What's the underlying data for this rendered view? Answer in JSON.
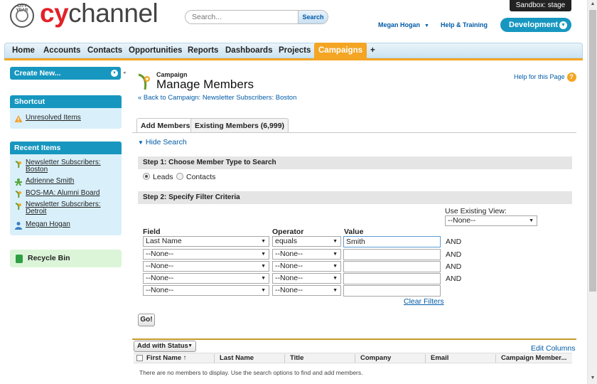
{
  "header": {
    "logo_brand": "cychannel",
    "logo_seal_text": "CITY YEAR",
    "search_placeholder": "Search...",
    "search_button": "Search",
    "user_name": "Megan Hogan",
    "help_link": "Help & Training",
    "app_menu": "Development",
    "sandbox_badge": "Sandbox:  stage"
  },
  "tabs": [
    {
      "label": "Home",
      "active": false
    },
    {
      "label": "Accounts",
      "active": false
    },
    {
      "label": "Contacts",
      "active": false
    },
    {
      "label": "Opportunities",
      "active": false
    },
    {
      "label": "Reports",
      "active": false
    },
    {
      "label": "Dashboards",
      "active": false
    },
    {
      "label": "Projects",
      "active": false
    },
    {
      "label": "Campaigns",
      "active": true
    },
    {
      "label": "+",
      "active": false
    }
  ],
  "sidebar": {
    "create_new": "Create New...",
    "shortcut_title": "Shortcut",
    "shortcut_items": [
      {
        "label": "Unresolved Items",
        "icon": "warning-icon"
      }
    ],
    "recent_title": "Recent Items",
    "recent_items": [
      {
        "label": "Newsletter Subscribers: Boston",
        "icon": "campaign-icon"
      },
      {
        "label": "Adrienne Smith",
        "icon": "lead-icon"
      },
      {
        "label": "BOS-MA: Alumni Board",
        "icon": "campaign-icon"
      },
      {
        "label": "Newsletter Subscribers: Detroit",
        "icon": "campaign-icon"
      },
      {
        "label": "Megan Hogan",
        "icon": "user-icon"
      }
    ],
    "recycle_bin": "Recycle Bin"
  },
  "page": {
    "type_label": "Campaign",
    "title": "Manage Members",
    "back_link": "« Back to Campaign: Newsletter Subscribers: Boston",
    "help_link": "Help for this Page",
    "subtabs": [
      {
        "label": "Add Members",
        "active": true
      },
      {
        "label": "Existing Members (6,999)",
        "active": false
      }
    ],
    "hide_search": "Hide Search",
    "step1_title": "Step 1: Choose Member Type to Search",
    "member_types": [
      {
        "label": "Leads",
        "selected": true
      },
      {
        "label": "Contacts",
        "selected": false
      }
    ],
    "step2_title": "Step 2: Specify Filter Criteria",
    "existing_view_label": "Use Existing View:",
    "existing_view_value": "--None--",
    "filter_headers": {
      "field": "Field",
      "operator": "Operator",
      "value": "Value"
    },
    "filters": [
      {
        "field": "Last Name",
        "operator": "equals",
        "value": "Smith",
        "conjunction": "AND"
      },
      {
        "field": "--None--",
        "operator": "--None--",
        "value": "",
        "conjunction": "AND"
      },
      {
        "field": "--None--",
        "operator": "--None--",
        "value": "",
        "conjunction": "AND"
      },
      {
        "field": "--None--",
        "operator": "--None--",
        "value": "",
        "conjunction": "AND"
      },
      {
        "field": "--None--",
        "operator": "--None--",
        "value": "",
        "conjunction": ""
      }
    ],
    "clear_filters": "Clear Filters",
    "go_button": "Go!"
  },
  "results": {
    "add_with_status": "Add with Status",
    "edit_columns": "Edit Columns",
    "columns": [
      "First Name ↑",
      "Last Name",
      "Title",
      "Company",
      "Email",
      "Campaign Member..."
    ],
    "empty_message": "There are no members to display. Use the search options to find and add members."
  },
  "colors": {
    "accent_blue": "#1797c0",
    "active_tab": "#f4a523",
    "link": "#015ba7",
    "brand_red": "#e32128"
  }
}
